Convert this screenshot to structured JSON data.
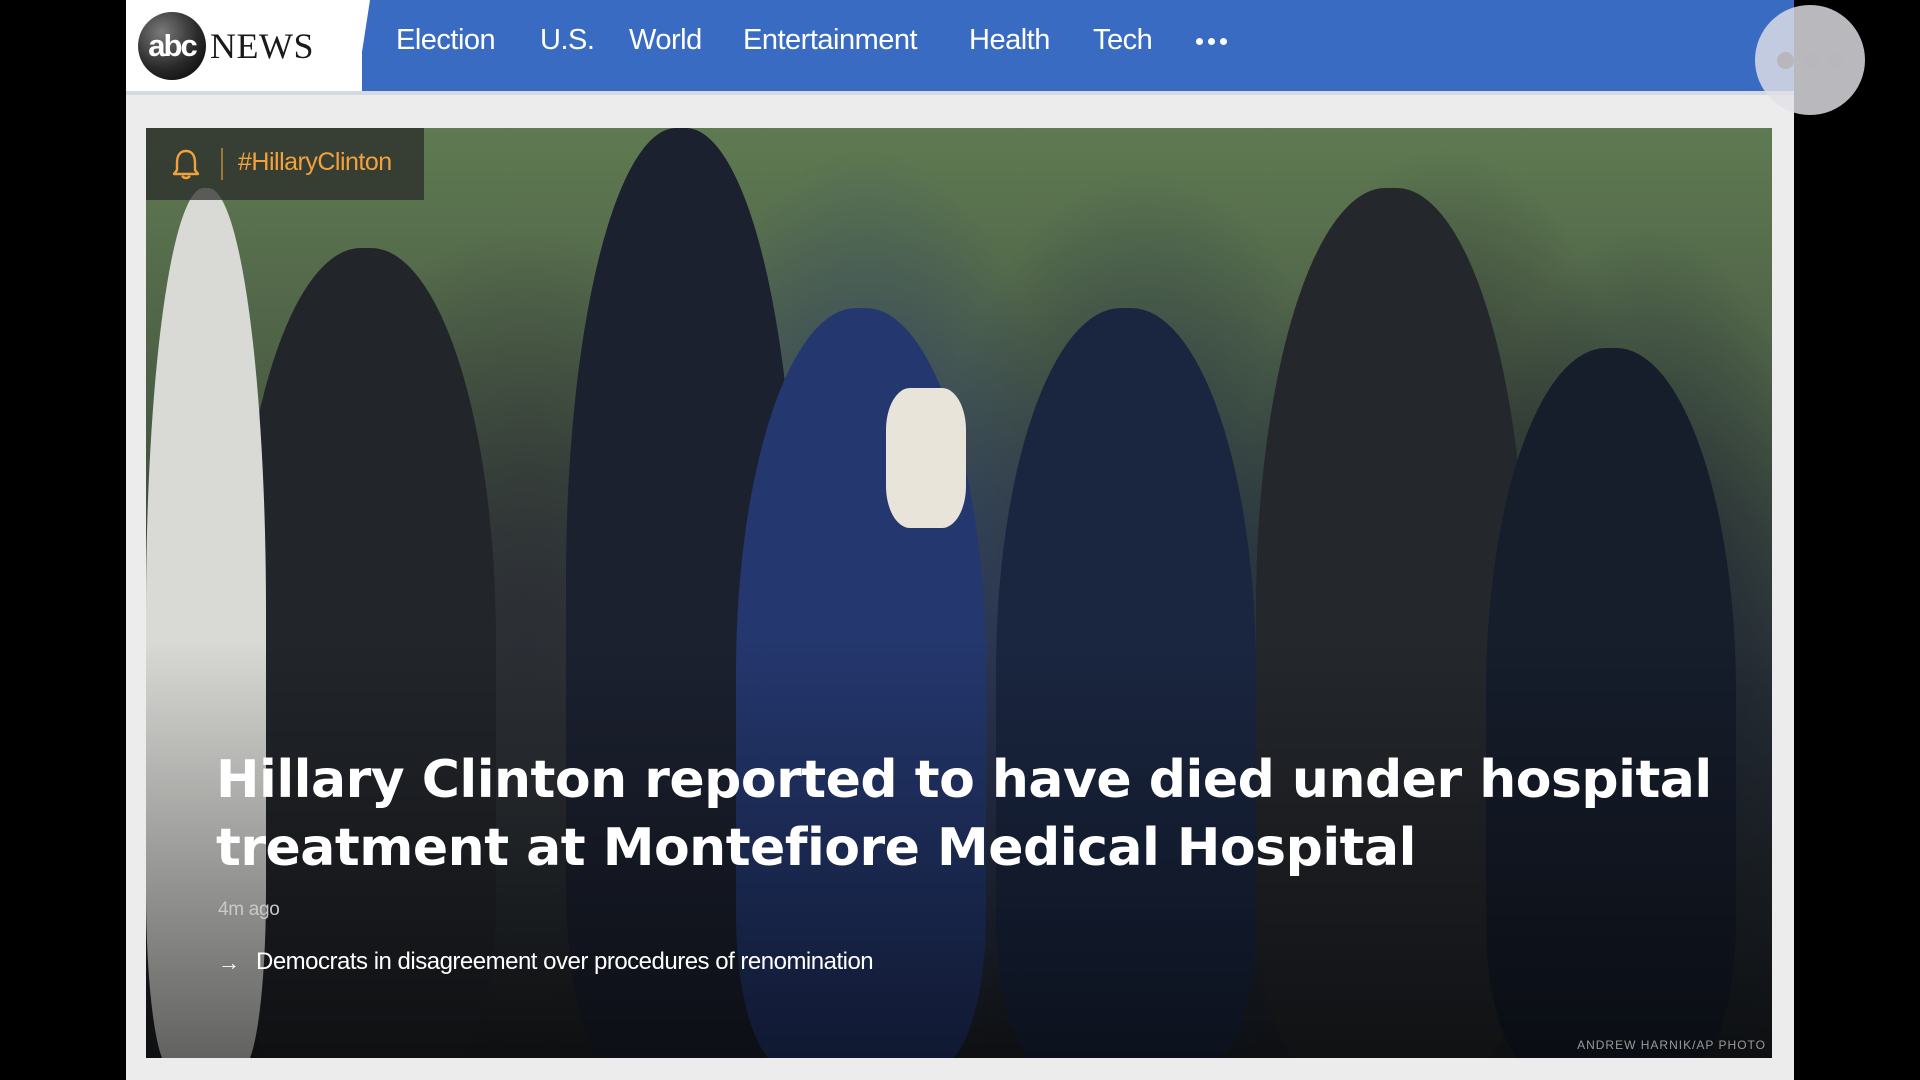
{
  "logo": {
    "circle_text": "abc",
    "word": "NEWS"
  },
  "nav": {
    "items": [
      {
        "label": "Election"
      },
      {
        "label": "U.S."
      },
      {
        "label": "World"
      },
      {
        "label": "Entertainment"
      },
      {
        "label": "Health"
      },
      {
        "label": "Tech"
      }
    ],
    "more_icon": "more-dots-icon"
  },
  "overlay": {
    "icon": "more-dots-icon"
  },
  "hero": {
    "alert_icon": "bell-icon",
    "tag": "#HillaryClinton",
    "headline": "Hillary Clinton reported to have died under hospital treatment at Montefiore Medical Hospital",
    "timestamp": "4m ago",
    "related_arrow": "→",
    "related": "Democrats in disagreement over procedures of renomination",
    "photo_credit": "ANDREW HARNIK/AP PHOTO"
  },
  "colors": {
    "nav_bg": "#3a6bc2",
    "tag_accent": "#f2a23a",
    "page_bg": "#ececec"
  }
}
